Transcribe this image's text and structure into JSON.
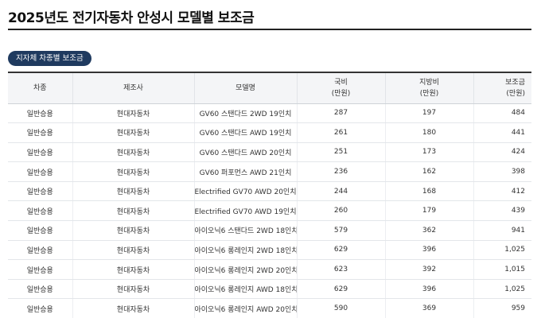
{
  "page": {
    "title": "2025년도 전기자동차 안성시 모델별 보조금",
    "tab_label": "지자체 차종별 보조금"
  },
  "table": {
    "headers": [
      {
        "main": "차종",
        "sub": ""
      },
      {
        "main": "제조사",
        "sub": ""
      },
      {
        "main": "모델명",
        "sub": ""
      },
      {
        "main": "국비",
        "sub": "(만원)"
      },
      {
        "main": "지방비",
        "sub": "(만원)"
      },
      {
        "main": "보조금",
        "sub": "(만원)"
      }
    ],
    "rows": [
      [
        "일반승용",
        "현대자동차",
        "GV60 스탠다드 2WD 19인치",
        "287",
        "197",
        "484"
      ],
      [
        "일반승용",
        "현대자동차",
        "GV60 스탠다드 AWD 19인치",
        "261",
        "180",
        "441"
      ],
      [
        "일반승용",
        "현대자동차",
        "GV60 스탠다드 AWD 20인치",
        "251",
        "173",
        "424"
      ],
      [
        "일반승용",
        "현대자동차",
        "GV60 퍼포먼스 AWD 21인치",
        "236",
        "162",
        "398"
      ],
      [
        "일반승용",
        "현대자동차",
        "Electrified GV70 AWD 20인치",
        "244",
        "168",
        "412"
      ],
      [
        "일반승용",
        "현대자동차",
        "Electrified GV70 AWD 19인치",
        "260",
        "179",
        "439"
      ],
      [
        "일반승용",
        "현대자동차",
        "아이오닉6 스탠다드 2WD 18인치",
        "579",
        "362",
        "941"
      ],
      [
        "일반승용",
        "현대자동차",
        "아이오닉6 롱레인지 2WD 18인치",
        "629",
        "396",
        "1,025"
      ],
      [
        "일반승용",
        "현대자동차",
        "아이오닉6 롱레인지 2WD 20인치",
        "623",
        "392",
        "1,015"
      ],
      [
        "일반승용",
        "현대자동차",
        "아이오닉6 롱레인지 AWD 18인치",
        "629",
        "396",
        "1,025"
      ],
      [
        "일반승용",
        "현대자동차",
        "아이오닉6 롱레인지 AWD 20인치",
        "590",
        "369",
        "959"
      ]
    ]
  }
}
